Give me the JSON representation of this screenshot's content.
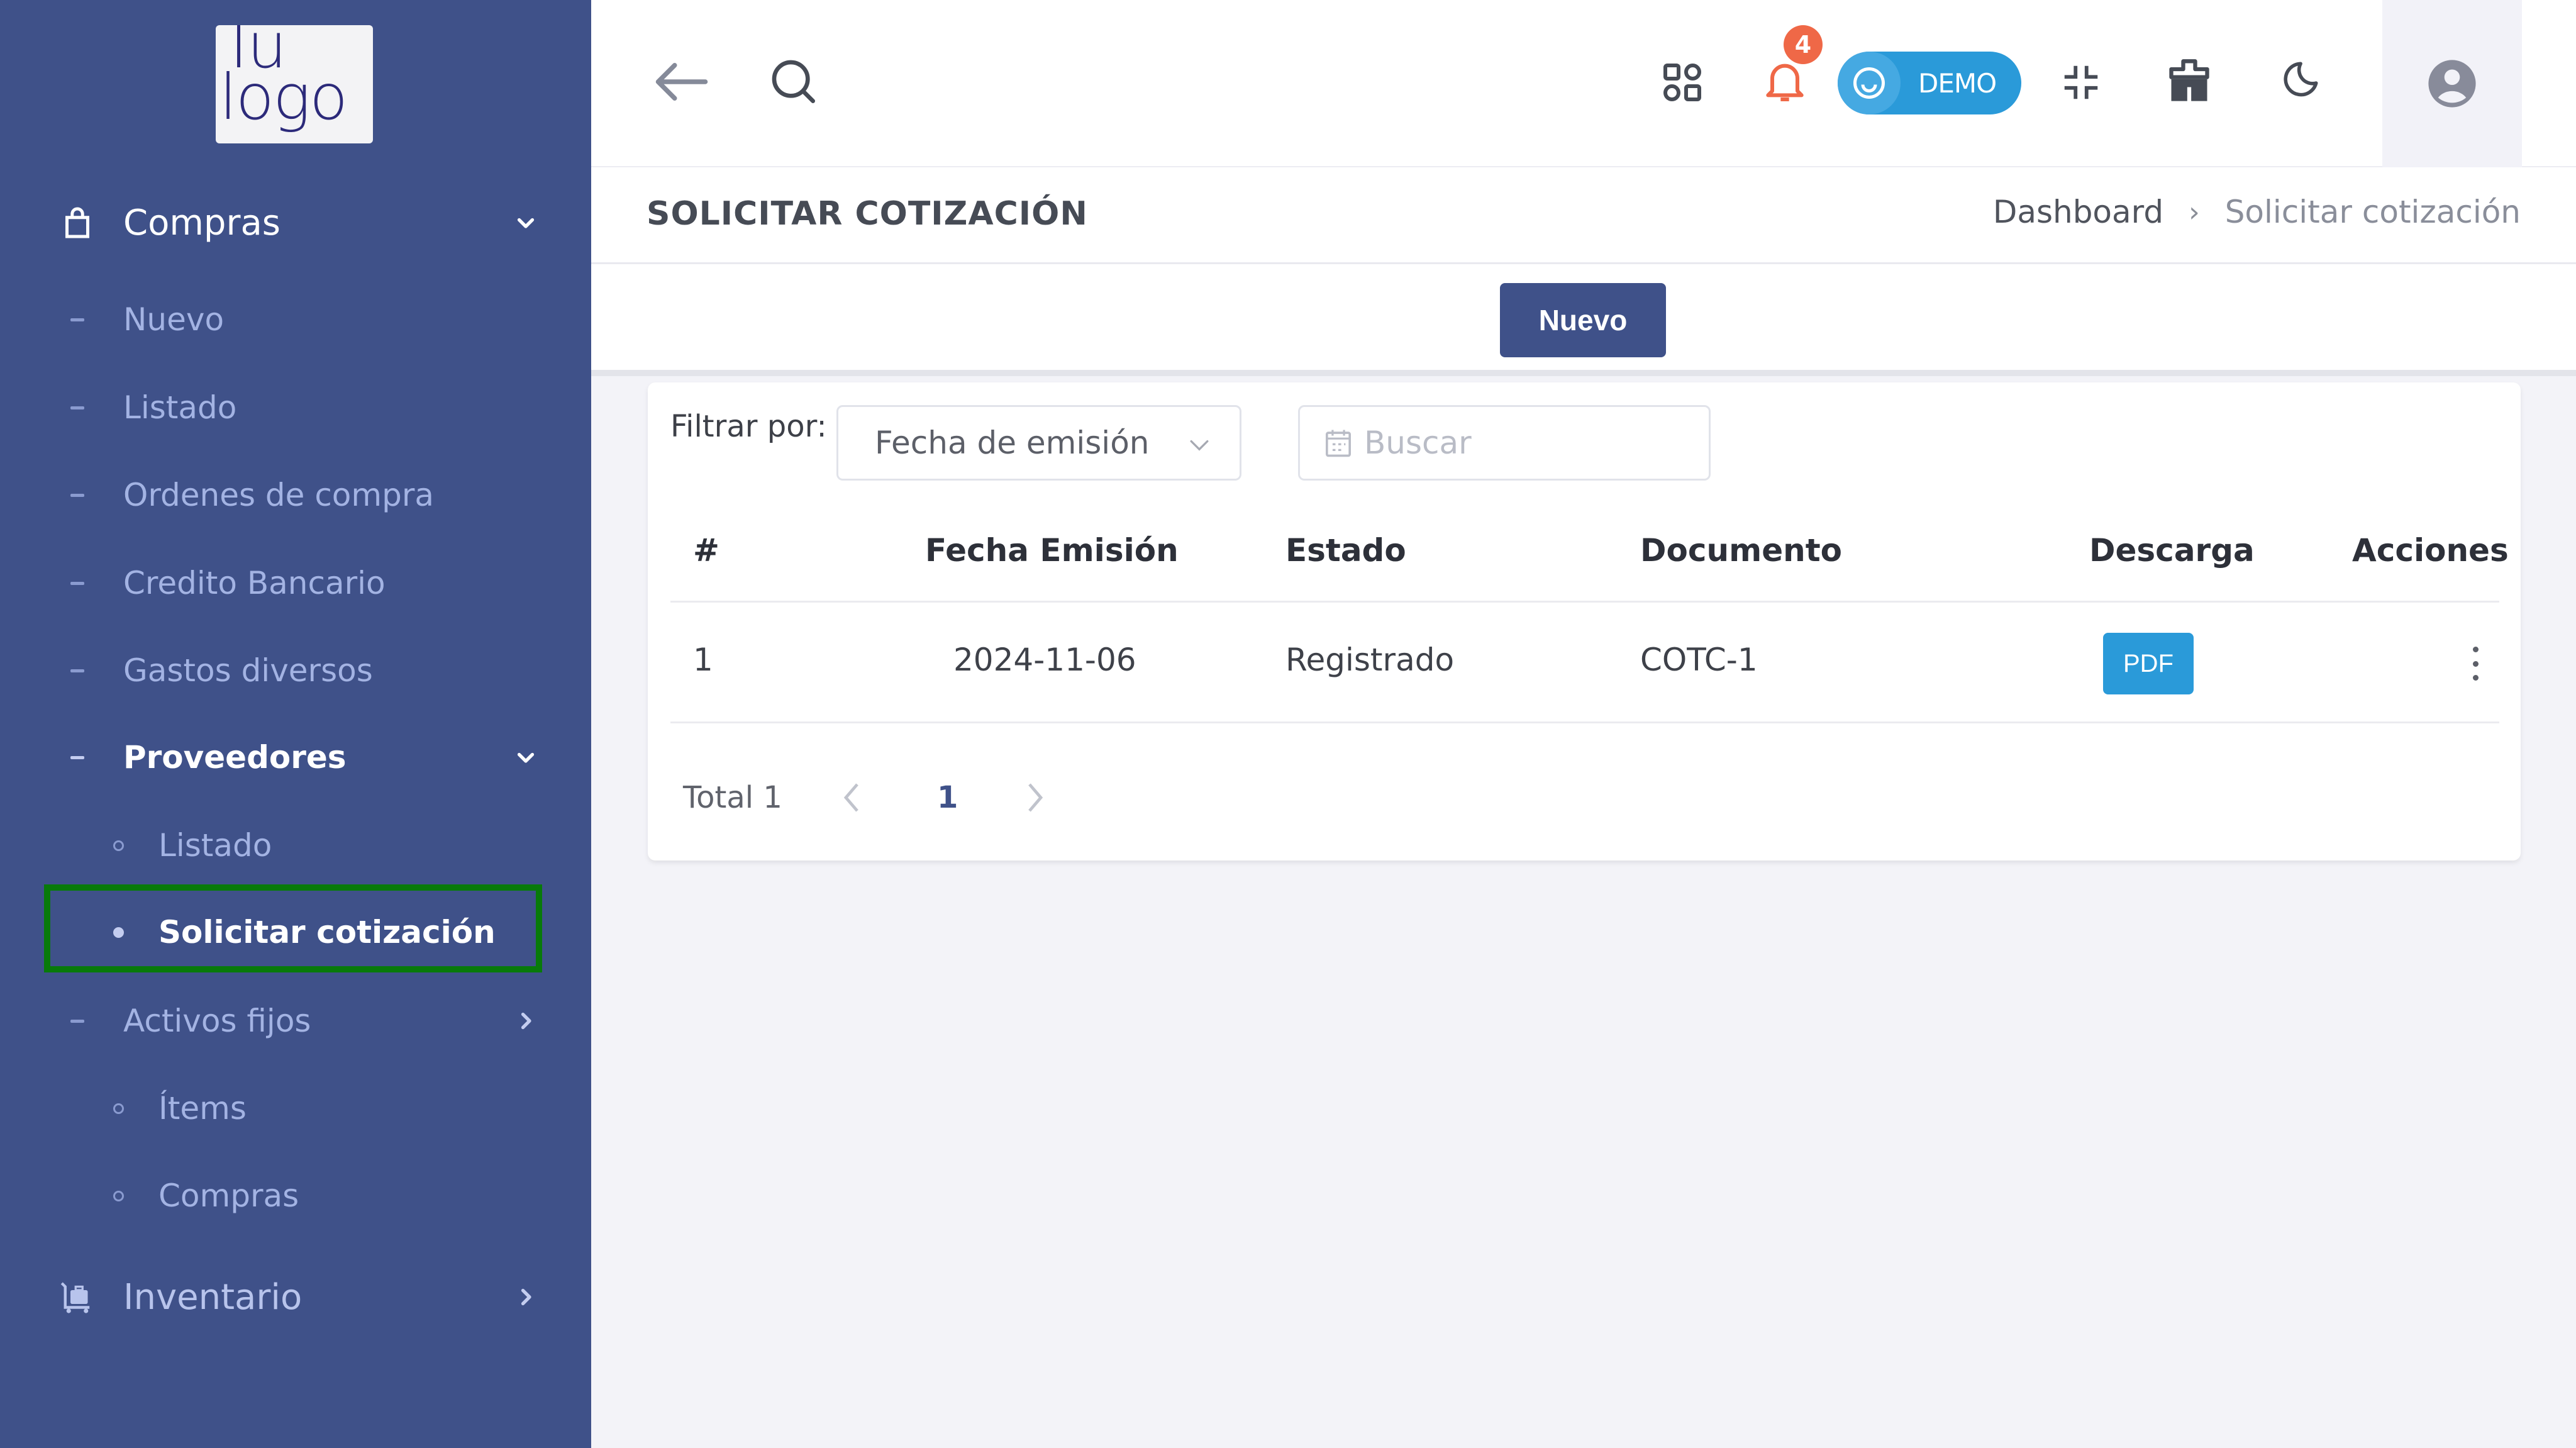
{
  "brand": {
    "logo_text": "Tu\nlogo"
  },
  "colors": {
    "sidebar_bg": "#3f5189",
    "accent_primary": "#3f5189",
    "accent_info": "#2a9ad9",
    "notification_badge": "#ef6847",
    "highlight_box": "#087a0a"
  },
  "sidebar": {
    "sections": [
      {
        "label": "Compras",
        "icon": "shopping-bag-icon",
        "expanded": true
      },
      {
        "label": "Inventario",
        "icon": "luggage-cart-icon",
        "expanded": false
      }
    ],
    "compras_items": [
      {
        "label": "Nuevo"
      },
      {
        "label": "Listado"
      },
      {
        "label": "Ordenes de compra"
      },
      {
        "label": "Credito Bancario"
      },
      {
        "label": "Gastos diversos"
      },
      {
        "label": "Proveedores",
        "expanded": true
      },
      {
        "label": "Activos fijos",
        "expanded": false
      }
    ],
    "proveedores_items": [
      {
        "label": "Listado"
      },
      {
        "label": "Solicitar cotización",
        "active": true
      }
    ],
    "activos_items": [
      {
        "label": "Ítems"
      },
      {
        "label": "Compras"
      }
    ]
  },
  "header": {
    "back_icon": "arrow-left-icon",
    "search_icon": "search-icon",
    "apps_icon": "apps-grid-icon",
    "notifications": {
      "icon": "bell-icon",
      "count": "4"
    },
    "demo_toggle": {
      "label": "DEMO",
      "icon": "smile-icon"
    },
    "fullscreen_icon": "compress-icon",
    "store_icon": "store-icon",
    "theme_icon": "moon-icon",
    "user_icon": "user-circle-icon"
  },
  "page": {
    "title": "SOLICITAR COTIZACIÓN",
    "breadcrumb": [
      "Dashboard",
      "Solicitar cotización"
    ],
    "breadcrumb_separator": "›"
  },
  "toolbar": {
    "new_label": "Nuevo"
  },
  "filters": {
    "label": "Filtrar por:",
    "filter_by": {
      "selected": "Fecha de emisión"
    },
    "search": {
      "placeholder": "Buscar",
      "value": ""
    }
  },
  "table": {
    "columns": [
      "#",
      "Fecha Emisión",
      "Estado",
      "Documento",
      "Descarga",
      "Acciones"
    ],
    "rows": [
      {
        "index": "1",
        "fecha_emision": "2024-11-06",
        "estado": "Registrado",
        "documento": "COTC-1",
        "descarga_label": "PDF"
      }
    ]
  },
  "pagination": {
    "total_label": "Total 1",
    "current_page": "1"
  }
}
